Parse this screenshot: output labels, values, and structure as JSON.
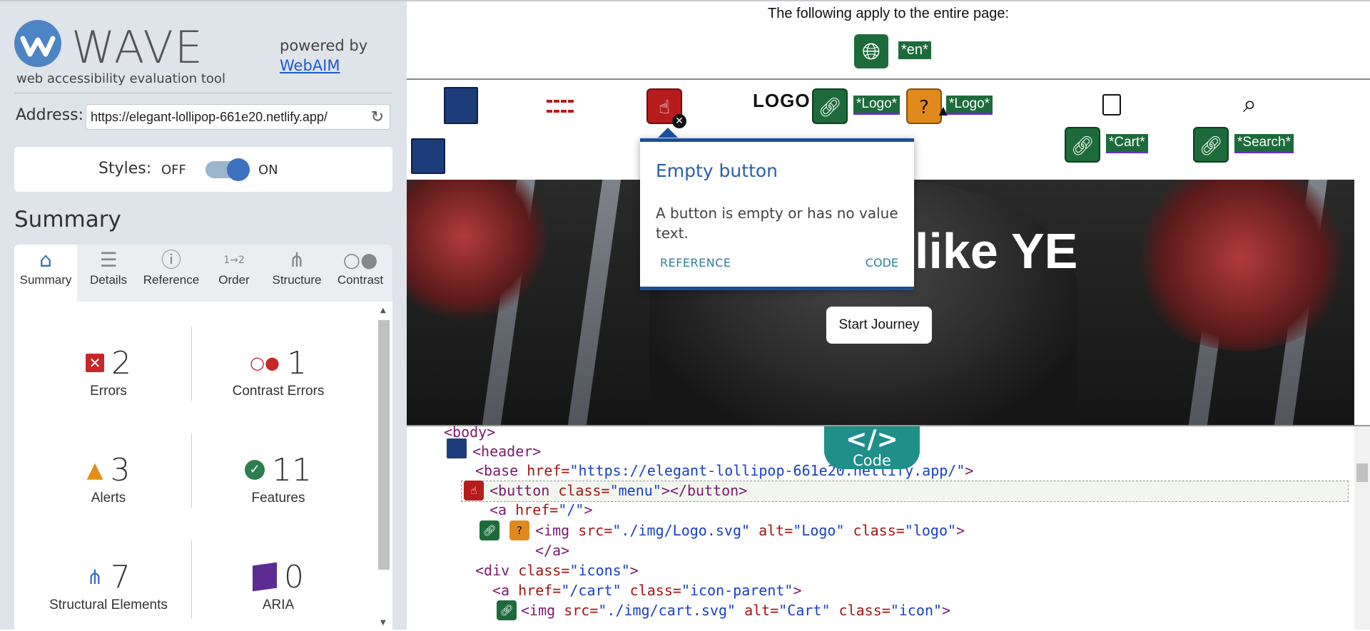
{
  "brand": {
    "title": "WAVE",
    "tagline": "web accessibility evaluation tool",
    "powered_by": "powered by",
    "webaim_link": "WebAIM"
  },
  "address": {
    "label": "Address:",
    "value": "https://elegant-lollipop-661e20.netlify.app/"
  },
  "styles": {
    "label": "Styles:",
    "off": "OFF",
    "on": "ON",
    "state": "on"
  },
  "summary": {
    "heading": "Summary",
    "tabs": [
      {
        "label": "Summary",
        "icon": "home-icon",
        "active": true
      },
      {
        "label": "Details",
        "icon": "list-icon"
      },
      {
        "label": "Reference",
        "icon": "info-icon"
      },
      {
        "label": "Order",
        "icon": "order-icon"
      },
      {
        "label": "Structure",
        "icon": "structure-icon"
      },
      {
        "label": "Contrast",
        "icon": "contrast-icon"
      }
    ],
    "metrics": {
      "errors": {
        "count": "2",
        "label": "Errors"
      },
      "contrast_errors": {
        "count": "1",
        "label": "Contrast Errors"
      },
      "alerts": {
        "count": "3",
        "label": "Alerts"
      },
      "features": {
        "count": "11",
        "label": "Features"
      },
      "structural": {
        "count": "7",
        "label": "Structural Elements"
      },
      "aria": {
        "count": "0",
        "label": "ARIA"
      }
    }
  },
  "page_top": {
    "text": "The following apply to the entire page:",
    "lang_tag": "*en*"
  },
  "site": {
    "logo_text": "LOGO",
    "logo_alt_1": "*Logo*",
    "logo_alt_2": "*Logo*",
    "cart_alt": "*Cart*",
    "search_alt": "*Search*",
    "hero_title": "like YE",
    "start_button": "Start Journey"
  },
  "popup": {
    "title": "Empty button",
    "description": "A button is empty or has no value text.",
    "reference": "REFERENCE",
    "code": "CODE"
  },
  "code_tab": {
    "icon": "</>",
    "label": "Code"
  },
  "code": {
    "body": "<body>",
    "header": "<header>",
    "base_tag": "<base ",
    "base_attr": "href=",
    "base_val": "\"https://elegant-lollipop-661e20.netlify.app/\"",
    "base_end": ">",
    "button_tag": "<button ",
    "button_attr": "class=",
    "button_val": "\"menu\"",
    "button_end": "></button>",
    "a_tag": "<a ",
    "a_attr": "href=",
    "a_val": "\"/\"",
    "a_end": ">",
    "img1_tag": "<img ",
    "img1_src_attr": "src=",
    "img1_src_val": "\"./img/Logo.svg\"",
    "img1_alt_attr": " alt=",
    "img1_alt_val": "\"Logo\"",
    "img1_class_attr": " class=",
    "img1_class_val": "\"logo\"",
    "img1_end": ">",
    "a_close": "</a>",
    "div_tag": "<div ",
    "div_attr": "class=",
    "div_val": "\"icons\"",
    "div_end": ">",
    "a2_tag": "<a ",
    "a2_href_attr": "href=",
    "a2_href_val": "\"/cart\"",
    "a2_class_attr": " class=",
    "a2_class_val": "\"icon-parent\"",
    "a2_end": ">",
    "img2_tag": "<img ",
    "img2_src_attr": "src=",
    "img2_src_val": "\"./img/cart.svg\"",
    "img2_alt_attr": " alt=",
    "img2_alt_val": "\"Cart\"",
    "img2_class_attr": " class=",
    "img2_class_val": "\"icon\"",
    "img2_end": ">"
  },
  "colors": {
    "wave_blue": "#4d84c4",
    "error_red": "#b71c1c",
    "feature_green": "#1d6b3a",
    "alert_orange": "#e08a1e",
    "code_teal": "#1f8f8a"
  }
}
